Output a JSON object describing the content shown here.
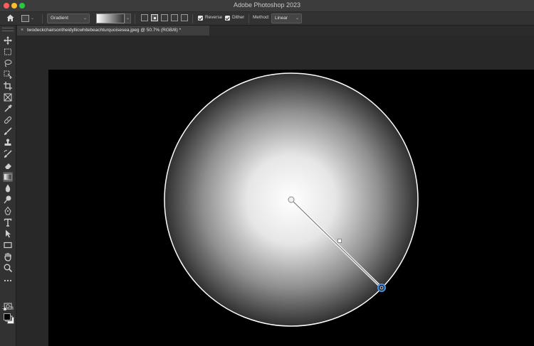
{
  "window": {
    "app_title": "Adobe Photoshop 2023"
  },
  "options_bar": {
    "tool_name": "Gradient",
    "reverse_label": "Reverse",
    "reverse_checked": true,
    "dither_label": "Dither",
    "dither_checked": true,
    "method_label": "Method:",
    "method_value": "Linear",
    "gradient_preview": {
      "from": "#ffffff",
      "to": "#303030"
    }
  },
  "document_tab": {
    "close_glyph": "×",
    "title": "twodeckchairsontheidyllicwhitebeachturquoisesea.jpeg @ 50.7% (RGB/8) *"
  },
  "toolbar": {
    "active_tool": "gradient-tool",
    "tools": [
      "move",
      "marquee",
      "lasso",
      "object-select",
      "crop",
      "frame",
      "eyedropper",
      "healing-brush",
      "brush",
      "clone-stamp",
      "history-brush",
      "eraser",
      "gradient",
      "blur",
      "dodge",
      "pen",
      "type",
      "path-select",
      "rectangle",
      "hand",
      "zoom",
      "more"
    ]
  },
  "colors": {
    "foreground": "#000000",
    "background": "#ffffff",
    "accent": "#4a90e2"
  },
  "canvas": {
    "background": "#000000",
    "gradient_type": "radial",
    "gradient_from": "#ffffff",
    "gradient_to": "#303030"
  }
}
